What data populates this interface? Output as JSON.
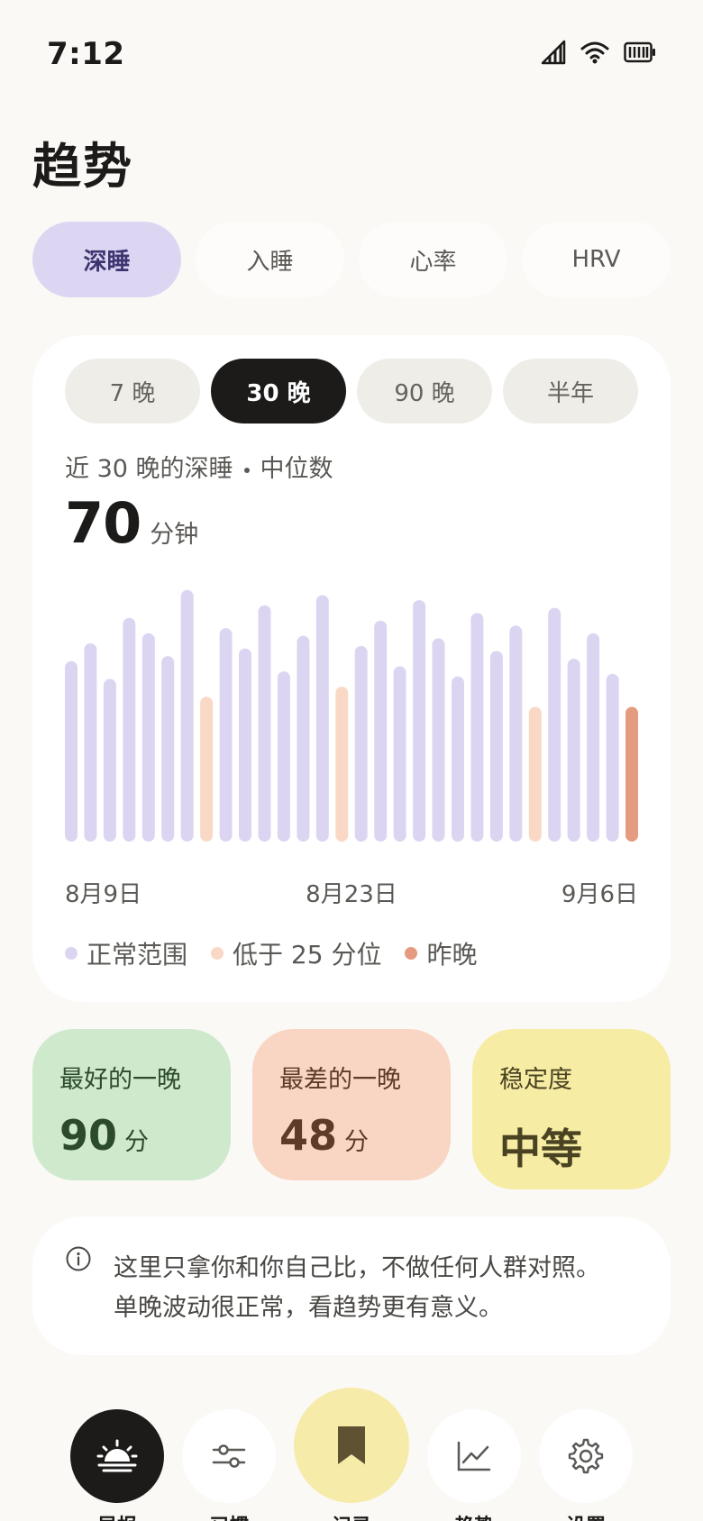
{
  "status": {
    "time": "7:12"
  },
  "title": "趋势",
  "metric_tabs": [
    {
      "label": "深睡",
      "active": true
    },
    {
      "label": "入睡",
      "active": false
    },
    {
      "label": "心率",
      "active": false
    },
    {
      "label": "HRV",
      "active": false
    }
  ],
  "range_tabs": [
    {
      "label": "7 晚",
      "active": false
    },
    {
      "label": "30 晚",
      "active": true
    },
    {
      "label": "90 晚",
      "active": false
    },
    {
      "label": "半年",
      "active": false
    }
  ],
  "chart_caption_left": "近 30 晚的深睡",
  "chart_caption_right": "中位数",
  "summary_value": "70",
  "summary_unit": "分钟",
  "chart_data": {
    "type": "bar",
    "ylim": [
      0,
      100
    ],
    "values": [
      71,
      78,
      64,
      88,
      82,
      73,
      99,
      57,
      84,
      76,
      93,
      67,
      81,
      97,
      61,
      77,
      87,
      69,
      95,
      80,
      65,
      90,
      75,
      85,
      53,
      92,
      72,
      82,
      66,
      53
    ],
    "categories_shown": [
      "8月9日",
      "8月23日",
      "9月6日"
    ],
    "low_indices": [
      7,
      14,
      24
    ],
    "last_index": 29,
    "legend": [
      "正常范围",
      "低于 25 分位",
      "昨晚"
    ],
    "colors": {
      "normal": "#dcd5f1",
      "low": "#f9d9c5",
      "last": "#e59b7f"
    }
  },
  "stats": [
    {
      "label": "最好的一晚",
      "value": "90",
      "unit": "分",
      "bg": "#cfe9cd",
      "fg": "#2c4a2c"
    },
    {
      "label": "最差的一晚",
      "value": "48",
      "unit": "分",
      "bg": "#f9d5c4",
      "fg": "#5e3a2a"
    },
    {
      "label": "稳定度",
      "value": "中等",
      "unit": "",
      "bg": "#f7eca4",
      "fg": "#4a4322"
    }
  ],
  "info": {
    "line1": "这里只拿你和你自己比，不做任何人群对照。",
    "line2": "单晚波动很正常，看趋势更有意义。"
  },
  "nav": [
    {
      "icon": "sunrise-icon",
      "label": "早报",
      "active": true
    },
    {
      "icon": "sliders-icon",
      "label": "习惯",
      "active": false
    },
    {
      "icon": "bookmark-icon",
      "label": "记录",
      "active": false
    },
    {
      "icon": "chart-line-icon",
      "label": "趋势",
      "active": false
    },
    {
      "icon": "gear-icon",
      "label": "设置",
      "active": false
    }
  ]
}
